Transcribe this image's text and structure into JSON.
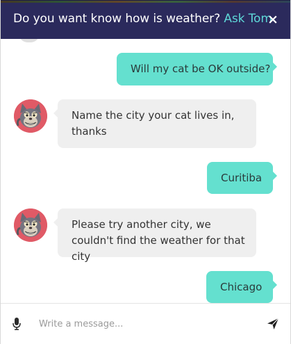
{
  "header": {
    "question": "Do you want know how is weather?",
    "ask_link": "Ask Tom",
    "close_label": "×"
  },
  "messages": [
    {
      "sender": "user",
      "text": "Will my cat be OK outside?"
    },
    {
      "sender": "bot",
      "avatar": "tom-cat-avatar",
      "text": "Name the city your cat lives in, thanks"
    },
    {
      "sender": "user",
      "text": "Curitiba"
    },
    {
      "sender": "bot",
      "avatar": "tom-cat-avatar",
      "text": "Please try another city, we couldn't find the weather for that city"
    },
    {
      "sender": "user",
      "text": "Chicago"
    }
  ],
  "composer": {
    "placeholder": "Write a message...",
    "mic_icon": "microphone-icon",
    "send_icon": "send-icon"
  },
  "colors": {
    "header_bg": "#2b2a5c",
    "ask_link": "#5ed8d8",
    "user_bubble": "#64e0cf",
    "bot_bubble": "#efefef",
    "avatar_bg": "#e05a66"
  }
}
